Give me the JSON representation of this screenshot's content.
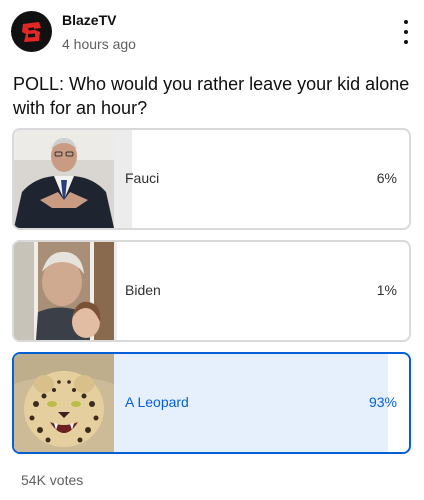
{
  "post": {
    "channel": "BlazeTV",
    "time": "4 hours ago",
    "avatar_icon": "blaze-logo-icon",
    "menu_icon": "more-vert-icon"
  },
  "poll": {
    "question": "POLL: Who would you rather leave your kid alone with for an hour?",
    "options": [
      {
        "label": "Fauci",
        "percent": "6%",
        "fill_fraction": 0.06,
        "selected": false,
        "thumbnail": "fauci-photo"
      },
      {
        "label": "Biden",
        "percent": "1%",
        "fill_fraction": 0.01,
        "selected": false,
        "thumbnail": "biden-photo"
      },
      {
        "label": "A Leopard",
        "percent": "93%",
        "fill_fraction": 0.93,
        "selected": true,
        "thumbnail": "leopard-photo"
      }
    ],
    "votes": "54K votes"
  },
  "colors": {
    "selected_accent": "#065fd4",
    "selected_fill": "#e6f0fc",
    "unselected_fill": "#ececec",
    "brand_red": "#e32726"
  }
}
